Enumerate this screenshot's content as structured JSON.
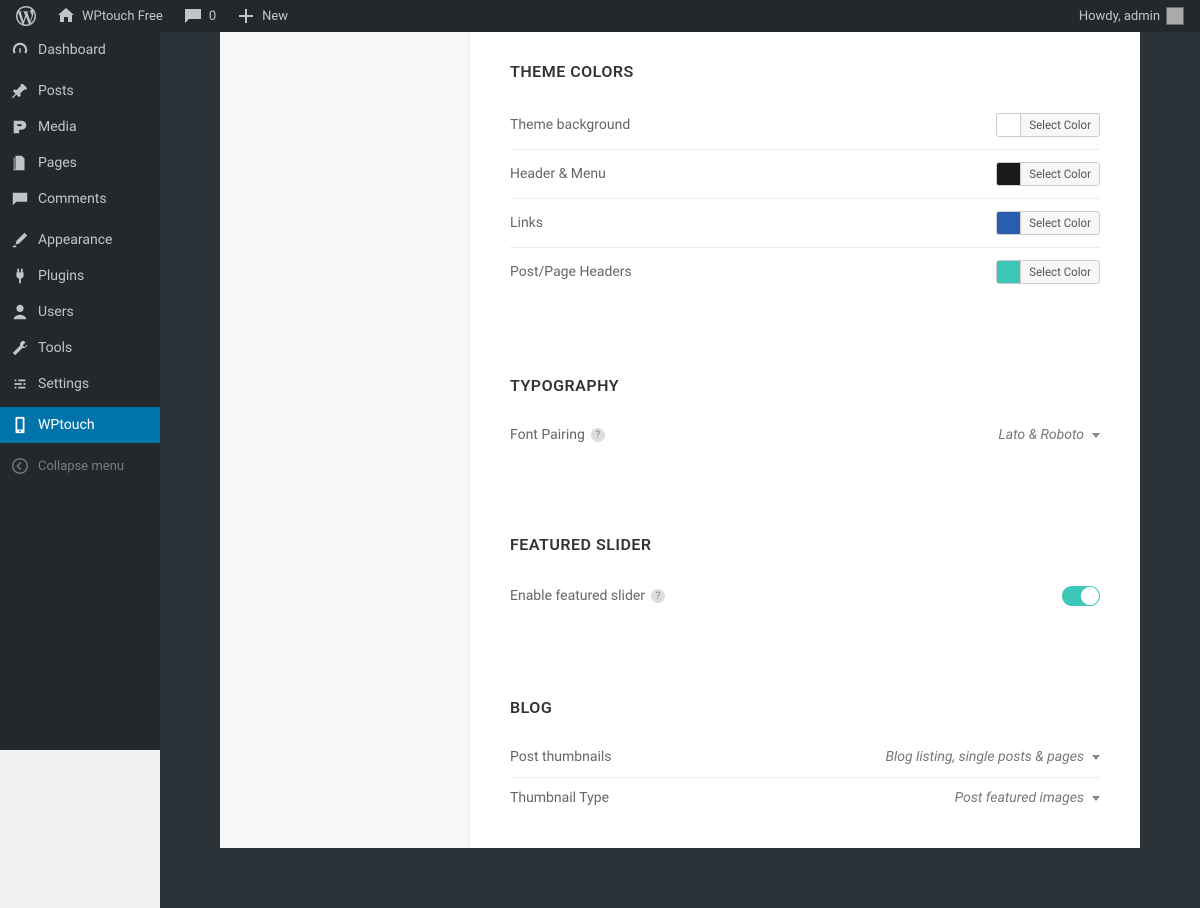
{
  "adminbar": {
    "site_name": "WPtouch Free",
    "comments_count": "0",
    "new_label": "New",
    "howdy": "Howdy, admin"
  },
  "sidebar": {
    "items": [
      {
        "label": "Dashboard",
        "icon": "dashboard"
      },
      {
        "label": "Posts",
        "icon": "pin"
      },
      {
        "label": "Media",
        "icon": "media"
      },
      {
        "label": "Pages",
        "icon": "pages"
      },
      {
        "label": "Comments",
        "icon": "comment"
      },
      {
        "label": "Appearance",
        "icon": "brush"
      },
      {
        "label": "Plugins",
        "icon": "plug"
      },
      {
        "label": "Users",
        "icon": "user"
      },
      {
        "label": "Tools",
        "icon": "wrench"
      },
      {
        "label": "Settings",
        "icon": "settings"
      },
      {
        "label": "WPtouch",
        "icon": "phone"
      }
    ],
    "collapse": "Collapse menu"
  },
  "sections": {
    "theme_colors": {
      "title": "THEME COLORS",
      "rows": [
        {
          "label": "Theme background",
          "color": "#ffffff",
          "button": "Select Color"
        },
        {
          "label": "Header & Menu",
          "color": "#1a1a1a",
          "button": "Select Color"
        },
        {
          "label": "Links",
          "color": "#2a5db0",
          "button": "Select Color"
        },
        {
          "label": "Post/Page Headers",
          "color": "#3cc7b7",
          "button": "Select Color"
        }
      ]
    },
    "typography": {
      "title": "TYPOGRAPHY",
      "font_pairing_label": "Font Pairing",
      "font_pairing_value": "Lato & Roboto"
    },
    "featured_slider": {
      "title": "FEATURED SLIDER",
      "label": "Enable featured slider",
      "enabled": true
    },
    "blog": {
      "title": "BLOG",
      "rows": [
        {
          "label": "Post thumbnails",
          "value": "Blog listing, single posts & pages"
        },
        {
          "label": "Thumbnail Type",
          "value": "Post featured images"
        }
      ]
    }
  }
}
